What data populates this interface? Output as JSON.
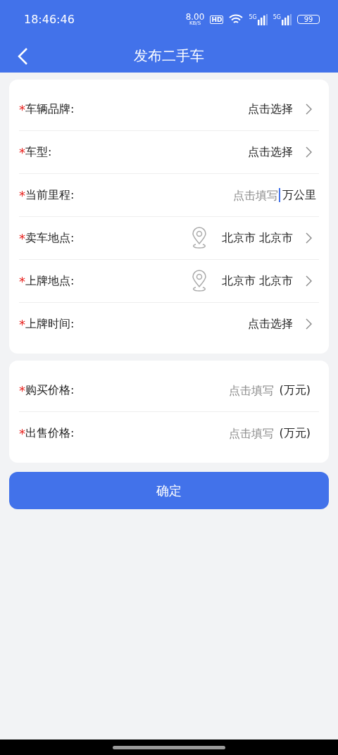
{
  "status_bar": {
    "time": "18:46:46",
    "speed": "8.00",
    "speed_unit": "KB/S",
    "hd": "HD",
    "signals": [
      "5G",
      "5G"
    ],
    "battery": "99"
  },
  "header": {
    "title": "发布二手车"
  },
  "sections": [
    {
      "rows": [
        {
          "kind": "select",
          "required_mark": "*",
          "label": "车辆品牌:",
          "value": "点击选择"
        },
        {
          "kind": "select",
          "required_mark": "*",
          "label": "车型:",
          "value": "点击选择"
        },
        {
          "kind": "input",
          "required_mark": "*",
          "label": "当前里程:",
          "placeholder": "点击填写",
          "unit": "万公里",
          "focused": true
        },
        {
          "kind": "location",
          "required_mark": "*",
          "label": "卖车地点:",
          "value": "北京市 北京市"
        },
        {
          "kind": "location",
          "required_mark": "*",
          "label": "上牌地点:",
          "value": "北京市 北京市"
        },
        {
          "kind": "select",
          "required_mark": "*",
          "label": "上牌时间:",
          "value": "点击选择"
        }
      ]
    },
    {
      "rows": [
        {
          "kind": "input",
          "required_mark": "*",
          "label": "购买价格:",
          "placeholder": "点击填写",
          "unit": "(万元)",
          "focused": false
        },
        {
          "kind": "input",
          "required_mark": "*",
          "label": "出售价格:",
          "placeholder": "点击填写",
          "unit": "(万元)",
          "focused": false
        }
      ]
    }
  ],
  "submit": "确定"
}
